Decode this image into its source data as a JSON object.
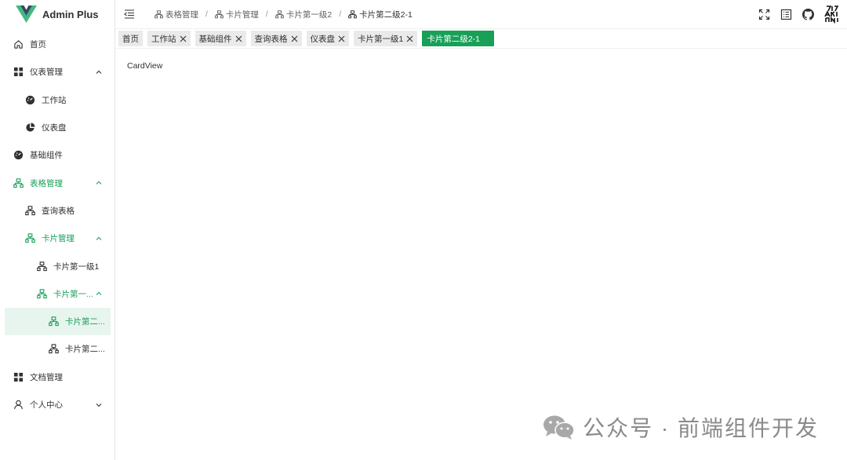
{
  "app": {
    "title": "Admin Plus"
  },
  "sidebar": {
    "items": [
      {
        "label": "首页",
        "icon": "home-icon"
      },
      {
        "label": "仪表管理",
        "icon": "grid-icon"
      },
      {
        "label": "工作站",
        "icon": "dashboard-gauge-icon"
      },
      {
        "label": "仪表盘",
        "icon": "pie-chart-icon"
      },
      {
        "label": "基础组件",
        "icon": "dashboard-gauge-icon"
      },
      {
        "label": "表格管理",
        "icon": "sitemap-icon"
      },
      {
        "label": "查询表格",
        "icon": "sitemap-icon"
      },
      {
        "label": "卡片管理",
        "icon": "sitemap-icon"
      },
      {
        "label": "卡片第一级1",
        "icon": "sitemap-icon"
      },
      {
        "label": "卡片第一...",
        "icon": "sitemap-icon"
      },
      {
        "label": "卡片第二...",
        "icon": "sitemap-icon"
      },
      {
        "label": "卡片第二...",
        "icon": "sitemap-icon"
      },
      {
        "label": "文档管理",
        "icon": "grid-icon"
      },
      {
        "label": "个人中心",
        "icon": "user-icon"
      }
    ]
  },
  "breadcrumb": [
    "表格管理",
    "卡片管理",
    "卡片第一级2",
    "卡片第二级2-1"
  ],
  "tabs": [
    {
      "label": "首页"
    },
    {
      "label": "工作站"
    },
    {
      "label": "基础组件"
    },
    {
      "label": "查询表格"
    },
    {
      "label": "仪表盘"
    },
    {
      "label": "卡片第一级1"
    },
    {
      "label": "卡片第二级2-1"
    }
  ],
  "main": {
    "content_text": "CardView"
  },
  "watermark": {
    "text": "公众号 · 前端组件开发"
  },
  "colors": {
    "accent": "#18a058",
    "selected_bg": "#e7f5ee",
    "tag_bg": "#eaeaea"
  }
}
